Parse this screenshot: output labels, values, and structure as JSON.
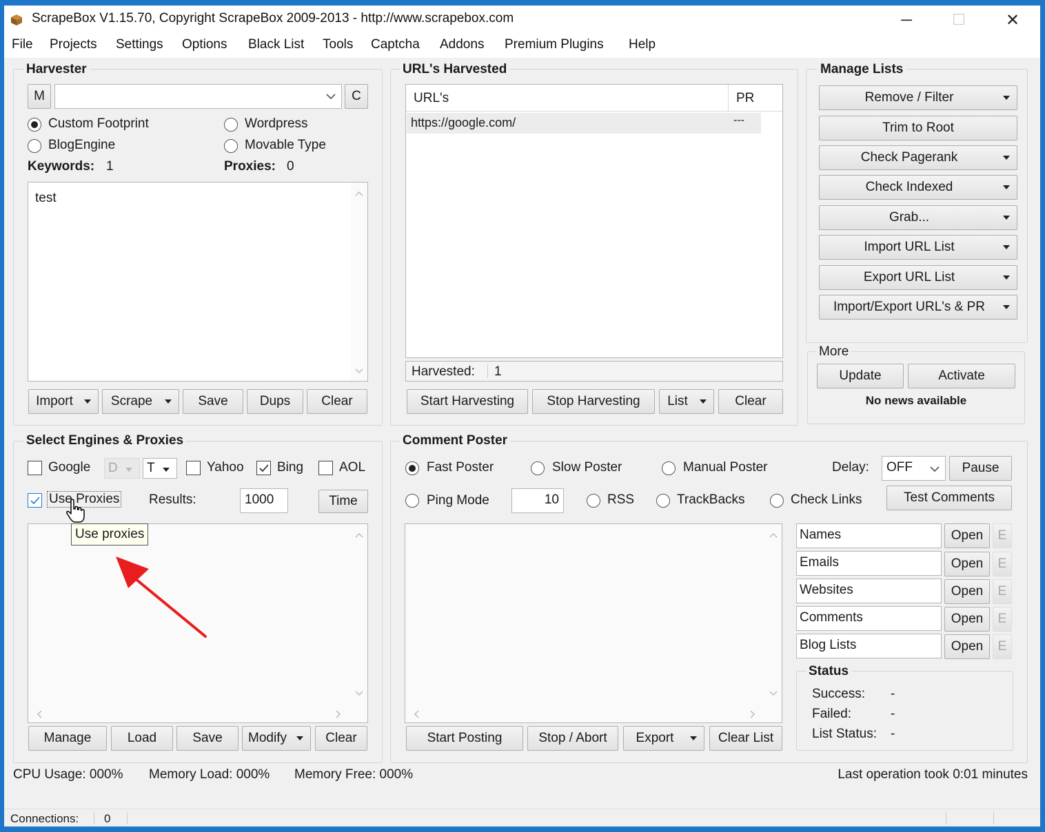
{
  "window": {
    "title": "ScrapeBox V1.15.70, Copyright ScrapeBox 2009-2013 - http://www.scrapebox.com",
    "minimize": "─",
    "maximize": "☐",
    "close": "✕"
  },
  "menu": [
    "File",
    "Projects",
    "Settings",
    "Options",
    "Black List",
    "Tools",
    "Captcha",
    "Addons",
    "Premium Plugins",
    "Help"
  ],
  "harvester": {
    "title": "Harvester",
    "m_button": "M",
    "c_button": "C",
    "footprint_value": "",
    "options": [
      "Custom Footprint",
      "Wordpress",
      "BlogEngine",
      "Movable Type"
    ],
    "keywords_label": "Keywords:",
    "keywords_count": "1",
    "proxies_label": "Proxies:",
    "proxies_count": "0",
    "keywords_text": "test",
    "buttons": [
      "Import",
      "Scrape",
      "Save",
      "Dups",
      "Clear"
    ]
  },
  "urls": {
    "title": "URL's Harvested",
    "col_url": "URL's",
    "col_pr": "PR",
    "rows": [
      {
        "url": "https://google.com/",
        "pr": "---"
      }
    ],
    "harvested_label": "Harvested:",
    "harvested_count": "1",
    "buttons": [
      "Start Harvesting",
      "Stop Harvesting",
      "List",
      "Clear"
    ]
  },
  "manage": {
    "title": "Manage Lists",
    "buttons": [
      "Remove / Filter",
      "Trim to Root",
      "Check Pagerank",
      "Check Indexed",
      "Grab...",
      "Import URL List",
      "Export URL List",
      "Import/Export URL's & PR"
    ]
  },
  "more": {
    "title": "More",
    "update": "Update",
    "activate": "Activate",
    "news": "No news available"
  },
  "engines": {
    "title": "Select Engines & Proxies",
    "google": "Google",
    "d": "D",
    "t": "T",
    "yahoo": "Yahoo",
    "bing": "Bing",
    "aol": "AOL",
    "use_proxies": "Use Proxies",
    "results_label": "Results:",
    "results_value": "1000",
    "time": "Time",
    "tooltip": "Use proxies",
    "buttons": [
      "Manage",
      "Load",
      "Save",
      "Modify",
      "Clear"
    ]
  },
  "poster": {
    "title": "Comment Poster",
    "fast": "Fast Poster",
    "slow": "Slow Poster",
    "manual": "Manual Poster",
    "delay_label": "Delay:",
    "delay_value": "OFF",
    "pause": "Pause",
    "ping": "Ping Mode",
    "ping_value": "10",
    "rss": "RSS",
    "trackbacks": "TrackBacks",
    "check_links": "Check Links",
    "test_comments": "Test Comments",
    "files": [
      "Names",
      "Emails",
      "Websites",
      "Comments",
      "Blog Lists"
    ],
    "open": "Open",
    "e": "E",
    "buttons": [
      "Start Posting",
      "Stop / Abort",
      "Export",
      "Clear List"
    ]
  },
  "status": {
    "title": "Status",
    "success_label": "Success:",
    "success_value": "-",
    "failed_label": "Failed:",
    "failed_value": "-",
    "list_label": "List Status:",
    "list_value": "-"
  },
  "footer": {
    "cpu": "CPU Usage: 000%",
    "memload": "Memory Load: 000%",
    "memfree": "Memory Free: 000%",
    "lastop": "Last operation took 0:01 minutes",
    "connections_label": "Connections:",
    "connections_value": "0"
  },
  "colors": {
    "annotation_arrow": "#e81d1d",
    "check_blue": "#1e78d6"
  }
}
